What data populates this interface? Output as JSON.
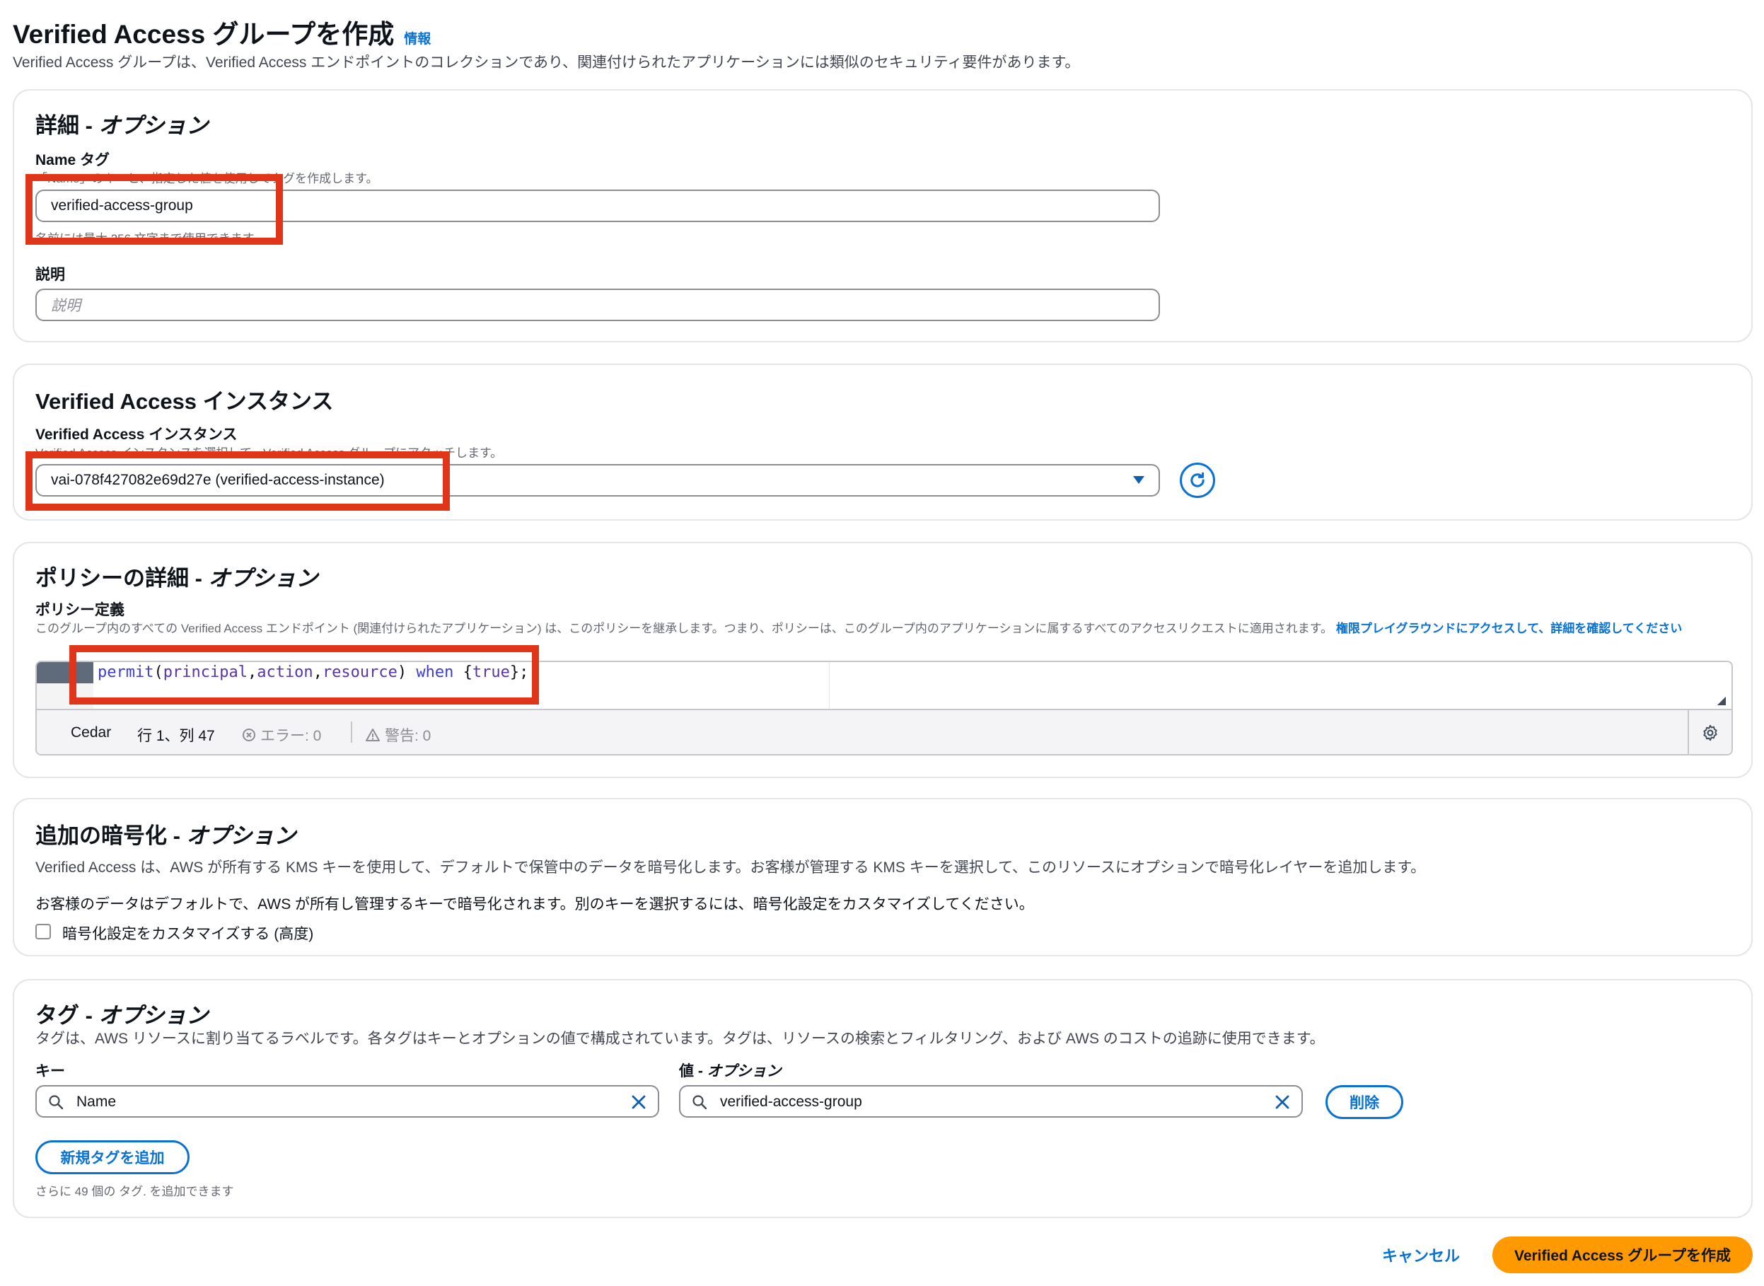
{
  "header": {
    "title": "Verified Access グループを作成",
    "info_link": "情報",
    "description": "Verified Access グループは、Verified Access エンドポイントのコレクションであり、関連付けられたアプリケーションには類似のセキュリティ要件があります。"
  },
  "details": {
    "title": "詳細 - ",
    "title_optional": "オプション",
    "name_tag_label": "Name タグ",
    "name_tag_hint": "「Name」のキーと、指定した値を使用してタグを作成します。",
    "name_tag_value": "verified-access-group",
    "name_tag_constraint": "名前には最大 256 文字まで使用できます。",
    "description_label": "説明",
    "description_placeholder": "説明"
  },
  "instance": {
    "title": "Verified Access インスタンス",
    "label": "Verified Access インスタンス",
    "hint": "Verified Access インスタンスを選択して、Verified Access グループにアタッチします。",
    "selected_value": "vai-078f427082e69d27e (verified-access-instance)"
  },
  "policy": {
    "title": "ポリシーの詳細 - ",
    "title_optional": "オプション",
    "label": "ポリシー定義",
    "hint": "このグループ内のすべての Verified Access エンドポイント (関連付けられたアプリケーション) は、このポリシーを継承します。つまり、ポリシーは、このグループ内のアプリケーションに属するすべてのアクセスリクエストに適用されます。",
    "hint_link": "権限プレイグラウンドにアクセスして、詳細を確認してください",
    "code": {
      "permit": "permit",
      "open": "(",
      "principal": "principal",
      "comma1": ",",
      "action": "action",
      "comma2": ",",
      "resource": "resource",
      "close": ")",
      "when": "when",
      "brace_open": "{",
      "true": "true",
      "brace_close": "};"
    },
    "status": {
      "language": "Cedar",
      "position": "行 1、列 47",
      "errors": "エラー: 0",
      "warnings": "警告: 0"
    }
  },
  "encryption": {
    "title": "追加の暗号化 - ",
    "title_optional": "オプション",
    "description1": "Verified Access は、AWS が所有する KMS キーを使用して、デフォルトで保管中のデータを暗号化します。お客様が管理する KMS キーを選択して、このリソースにオプションで暗号化レイヤーを追加します。",
    "description2": "お客様のデータはデフォルトで、AWS が所有し管理するキーで暗号化されます。別のキーを選択するには、暗号化設定をカスタマイズしてください。",
    "checkbox_label": "暗号化設定をカスタマイズする (高度)"
  },
  "tags": {
    "title": "タグ - ",
    "title_optional": "オプション",
    "description": "タグは、AWS リソースに割り当てるラベルです。各タグはキーとオプションの値で構成されています。タグは、リソースの検索とフィルタリング、および AWS のコストの追跡に使用できます。",
    "key_label": "キー",
    "value_label": "値 - ",
    "value_label_optional": "オプション",
    "key_value": "Name",
    "value_value": "verified-access-group",
    "remove_button": "削除",
    "add_button": "新規タグを追加",
    "remaining": "さらに 49 個の タグ. を追加できます"
  },
  "footer": {
    "cancel": "キャンセル",
    "create": "Verified Access グループを作成"
  },
  "colors": {
    "accent": "#0972d3",
    "primary_button": "#ff9900",
    "highlight": "#e03518"
  }
}
